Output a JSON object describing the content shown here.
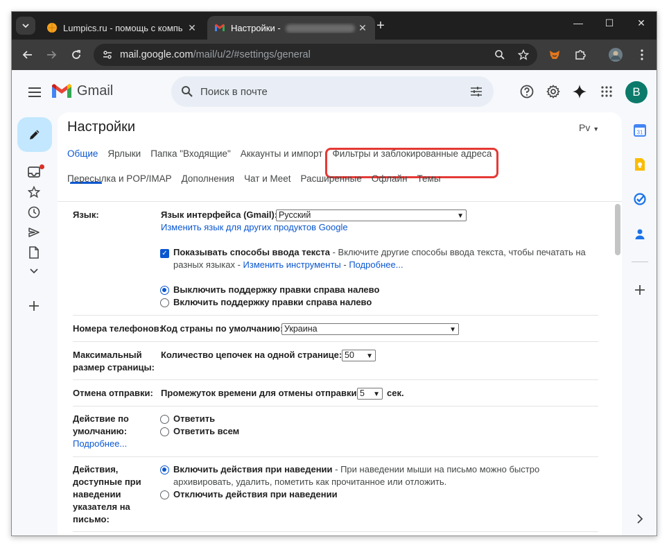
{
  "browser": {
    "tabs": [
      {
        "title": "Lumpics.ru - помощь с компь",
        "active": false
      },
      {
        "title": "Настройки - ",
        "active": true
      }
    ],
    "url_host": "mail.google.com",
    "url_path": "/mail/u/2/#settings/general"
  },
  "gmail": {
    "logo_text": "Gmail",
    "search_placeholder": "Поиск в почте",
    "avatar_letter": "В"
  },
  "settings": {
    "title": "Настройки",
    "lang_button": "Pv",
    "tabs_row1": [
      "Общие",
      "Ярлыки",
      "Папка \"Входящие\"",
      "Аккаунты и импорт",
      "Фильтры и заблокированные адреса"
    ],
    "tabs_row2": [
      "Пересылка и POP/IMAP",
      "Дополнения",
      "Чат и Meet",
      "Расширенные",
      "Офлайн",
      "Темы"
    ],
    "active_tab": "Общие",
    "highlighted_tab": "Фильтры и заблокированные адреса",
    "language": {
      "label": "Язык:",
      "interface_label": "Язык интерфейса (Gmail):",
      "interface_value": "Русский",
      "change_link": "Изменить язык для других продуктов Google",
      "input_methods_label": "Показывать способы ввода текста",
      "input_methods_desc1": " - Включите другие способы ввода текста, чтобы печатать на",
      "input_methods_desc2": "разных языках - ",
      "change_tools_link": "Изменить инструменты",
      "dash": " - ",
      "more_link": "Подробнее...",
      "input_methods_checked": true,
      "rtl_off": "Выключить поддержку правки справа налево",
      "rtl_on": "Включить поддержку правки справа налево",
      "rtl_selected": "off"
    },
    "phone": {
      "label": "Номера телефонов:",
      "country_label": "Код страны по умолчанию:",
      "country_value": "Украина"
    },
    "page_size": {
      "label_line1": "Максимальный",
      "label_line2": "размер страницы:",
      "threads_label": "Количество цепочек на одной странице:",
      "threads_value": "50"
    },
    "undo_send": {
      "label": "Отмена отправки:",
      "period_label": "Промежуток времени для отмены отправки:",
      "period_value": "5",
      "unit": "сек."
    },
    "default_reply": {
      "label_line1": "Действие по",
      "label_line2": "умолчанию:",
      "more_link": "Подробнее...",
      "reply": "Ответить",
      "reply_all": "Ответить всем"
    },
    "hover_actions": {
      "label_lines": [
        "Действия,",
        "доступные при",
        "наведении",
        "указателя на",
        "письмо:"
      ],
      "enable": "Включить действия при наведении",
      "enable_desc1": " - При наведении мыши на письмо можно быстро",
      "enable_desc2": "архивировать, удалить, пометить как прочитанное или отложить.",
      "disable": "Отключить действия при наведении",
      "selected": "enable"
    }
  },
  "colors": {
    "accent_blue": "#0b57d0",
    "highlight_red": "#e53935",
    "compose_bg": "#c2e7ff",
    "avatar_bg": "#0b7a6b"
  }
}
